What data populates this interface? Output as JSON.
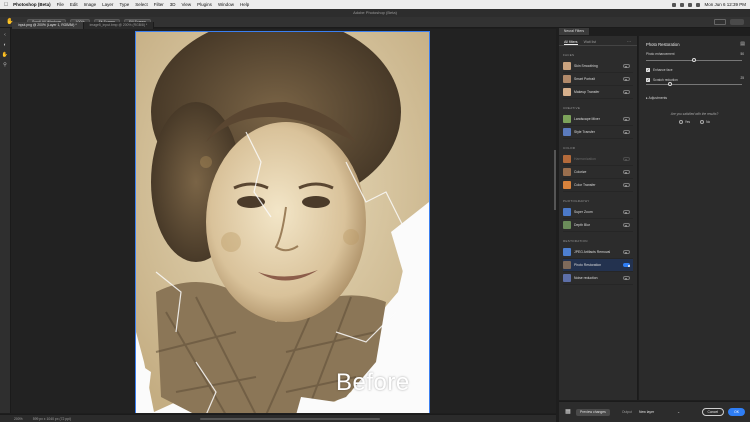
{
  "menubar": {
    "app_name": "Photoshop (Beta)",
    "items": [
      "File",
      "Edit",
      "Image",
      "Layer",
      "Type",
      "Select",
      "Filter",
      "3D",
      "View",
      "Plugins",
      "Window",
      "Help"
    ],
    "clock": "Mon Jun 6  12:39 PM"
  },
  "window": {
    "title": "Adobe Photoshop (Beta)"
  },
  "options": {
    "scroll_all_windows": "Scroll All Windows",
    "zoom": "100%",
    "fit_screen": "Fit Screen",
    "fill_screen": "Fill Screen"
  },
  "tabs": [
    {
      "label": "input.png @ 200% (Layer 1, RGB/8#) *"
    },
    {
      "label": "image5_input.bmp @ 200% (RGB/8) *"
    }
  ],
  "canvas": {
    "overlay_text": "Before"
  },
  "status": {
    "zoom": "200%",
    "doc_size": "599 px x 1040 px (72 ppi)"
  },
  "panel_tab": "Neural Filters",
  "filters": {
    "tab_all": "All filters",
    "tab_waitlist": "Wait list",
    "sections": [
      {
        "title": "FACES",
        "items": [
          {
            "label": "Skin Smoothing",
            "state": "off",
            "thumb": "#c9a27e"
          },
          {
            "label": "Smart Portrait",
            "state": "off",
            "thumb": "#b28a6a"
          },
          {
            "label": "Makeup Transfer",
            "state": "off",
            "thumb": "#d7b08c"
          }
        ]
      },
      {
        "title": "CREATIVE",
        "items": [
          {
            "label": "Landscape Mixer",
            "state": "off",
            "thumb": "#7ca35a"
          },
          {
            "label": "Style Transfer",
            "state": "off",
            "thumb": "#5b7bbd"
          }
        ]
      },
      {
        "title": "COLOR",
        "items": [
          {
            "label": "Harmonization",
            "state": "disabled",
            "thumb": "#b46a3a"
          },
          {
            "label": "Colorize",
            "state": "off",
            "thumb": "#9a6f4e"
          },
          {
            "label": "Color Transfer",
            "state": "off",
            "thumb": "#d9833c"
          }
        ]
      },
      {
        "title": "PHOTOGRAPHY",
        "items": [
          {
            "label": "Super Zoom",
            "state": "off",
            "thumb": "#4b79c8"
          },
          {
            "label": "Depth Blur",
            "state": "off",
            "thumb": "#6b8c5a"
          }
        ]
      },
      {
        "title": "RESTORATION",
        "items": [
          {
            "label": "JPEG Artifacts Removal",
            "state": "off",
            "thumb": "#4d7fd0"
          },
          {
            "label": "Photo Restoration",
            "state": "on",
            "thumb": "#7e6a5a"
          },
          {
            "label": "Noise reduction",
            "state": "off",
            "thumb": "#5d6fa8"
          }
        ]
      }
    ]
  },
  "settings": {
    "title": "Photo Restoration",
    "photo_enhancement": {
      "label": "Photo enhancement",
      "value": "50",
      "level": 0.5
    },
    "enhance_face": {
      "label": "Enhance face",
      "checked": true
    },
    "scratch_reduction": {
      "label": "Scratch reduction",
      "checked": true,
      "value": "25",
      "level": 0.25
    },
    "adjustments": "Adjustments",
    "satisfied_question": "Are you satisfied with the results?",
    "yes": "Yes",
    "no": "No"
  },
  "bottom": {
    "preview_changes": "Preview changes",
    "output_label": "Output",
    "output_value": "New layer",
    "cancel": "Cancel",
    "ok": "OK"
  }
}
